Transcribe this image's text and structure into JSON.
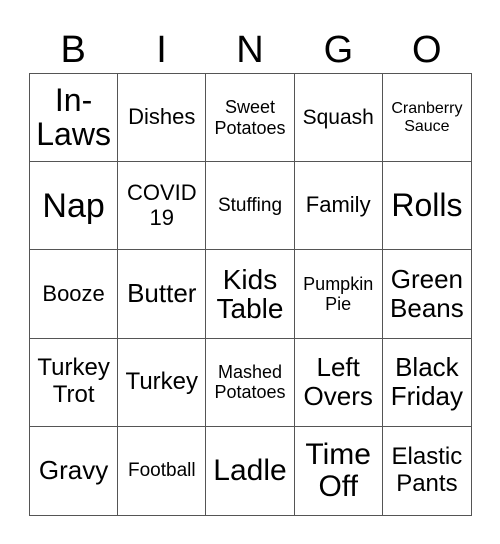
{
  "header": {
    "letters": [
      "B",
      "I",
      "N",
      "G",
      "O"
    ]
  },
  "grid": {
    "rows": [
      [
        "In-\nLaws",
        "Dishes",
        "Sweet\nPotatoes",
        "Squash",
        "Cranberry\nSauce"
      ],
      [
        "Nap",
        "COVID\n19",
        "Stuffing",
        "Family",
        "Rolls"
      ],
      [
        "Booze",
        "Butter",
        "Kids\nTable",
        "Pumpkin\nPie",
        "Green\nBeans"
      ],
      [
        "Turkey\nTrot",
        "Turkey",
        "Mashed\nPotatoes",
        "Left\nOvers",
        "Black\nFriday"
      ],
      [
        "Gravy",
        "Football",
        "Ladle",
        "Time\nOff",
        "Elastic\nPants"
      ]
    ]
  }
}
